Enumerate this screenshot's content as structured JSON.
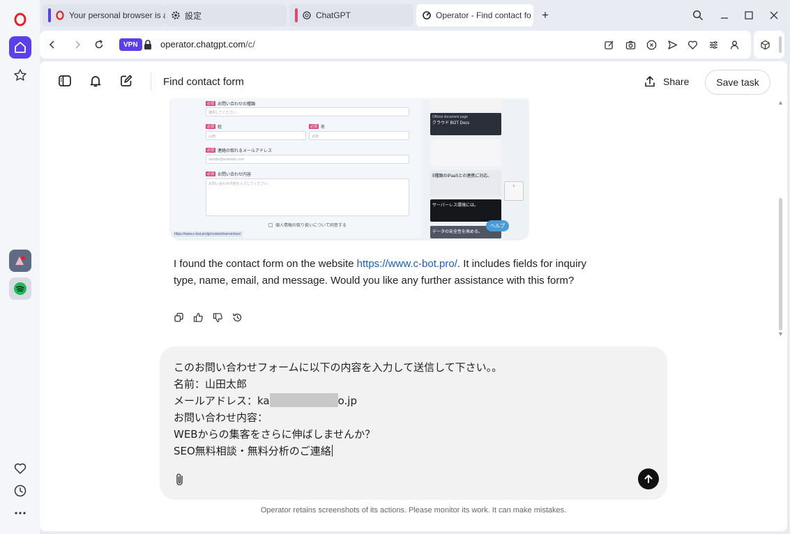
{
  "browser": {
    "tabs": [
      {
        "label": "Your personal browser is a"
      },
      {
        "label": "設定"
      },
      {
        "label": "ChatGPT"
      },
      {
        "label": "Operator - Find contact fo"
      }
    ],
    "new_tab": "+",
    "vpn": "VPN",
    "url_host": "operator.chatgpt.com",
    "url_path": "/c/"
  },
  "header": {
    "title": "Find contact form",
    "share": "Share",
    "save_task": "Save task"
  },
  "screenshot": {
    "form": {
      "req": "必須",
      "inquiry_type_label": "お問い合わせの種類",
      "inquiry_type_placeholder": "選択してください",
      "last_name_label": "姓",
      "last_name_placeholder": "山田",
      "first_name_label": "名",
      "first_name_placeholder": "太郎",
      "email_label": "連絡の取れるメールアドレス",
      "email_placeholder": "sample@example.com",
      "message_label": "お問い合わせ内容",
      "message_placeholder": "お問い合わせ内容を入力してください。",
      "privacy": "個人情報の取り扱いについて同意する",
      "status_url": "https://www.c-bot.pro/jp/content/serverless/"
    },
    "ads": {
      "docs_small": "Official document page",
      "docs": "クラウド BOT Docs",
      "ipaas": "5種類のiPaaSとの連携に対応。",
      "serverless": "サーバーレス環境には。",
      "bottom": "データの安全性を高める。",
      "help": "ヘルプ"
    }
  },
  "message": {
    "before_link": "I found the contact form on the website ",
    "link": "https://www.c-bot.pro/",
    "after_link": ". It includes fields for inquiry type, name, email, and message. Would you like any further assistance with this form?"
  },
  "composer": {
    "line1": "このお問い合わせフォームに以下の内容を入力して送信して下さい。。",
    "line2": "名前：山田太郎",
    "line3_prefix": "メールアドレス：ka",
    "line3_suffix": "o.jp",
    "line4": "お問い合わせ内容：",
    "line5": "WEBからの集客をさらに伸ばしませんか？",
    "line6": "SEO無料相談・無料分析のご連絡"
  },
  "footer": "Operator retains screenshots of its actions. Please monitor its work. It can make mistakes.",
  "colors": {
    "opera_red": "#e0232b",
    "accent": "#5b3fe8",
    "link": "#1a5fb4"
  }
}
